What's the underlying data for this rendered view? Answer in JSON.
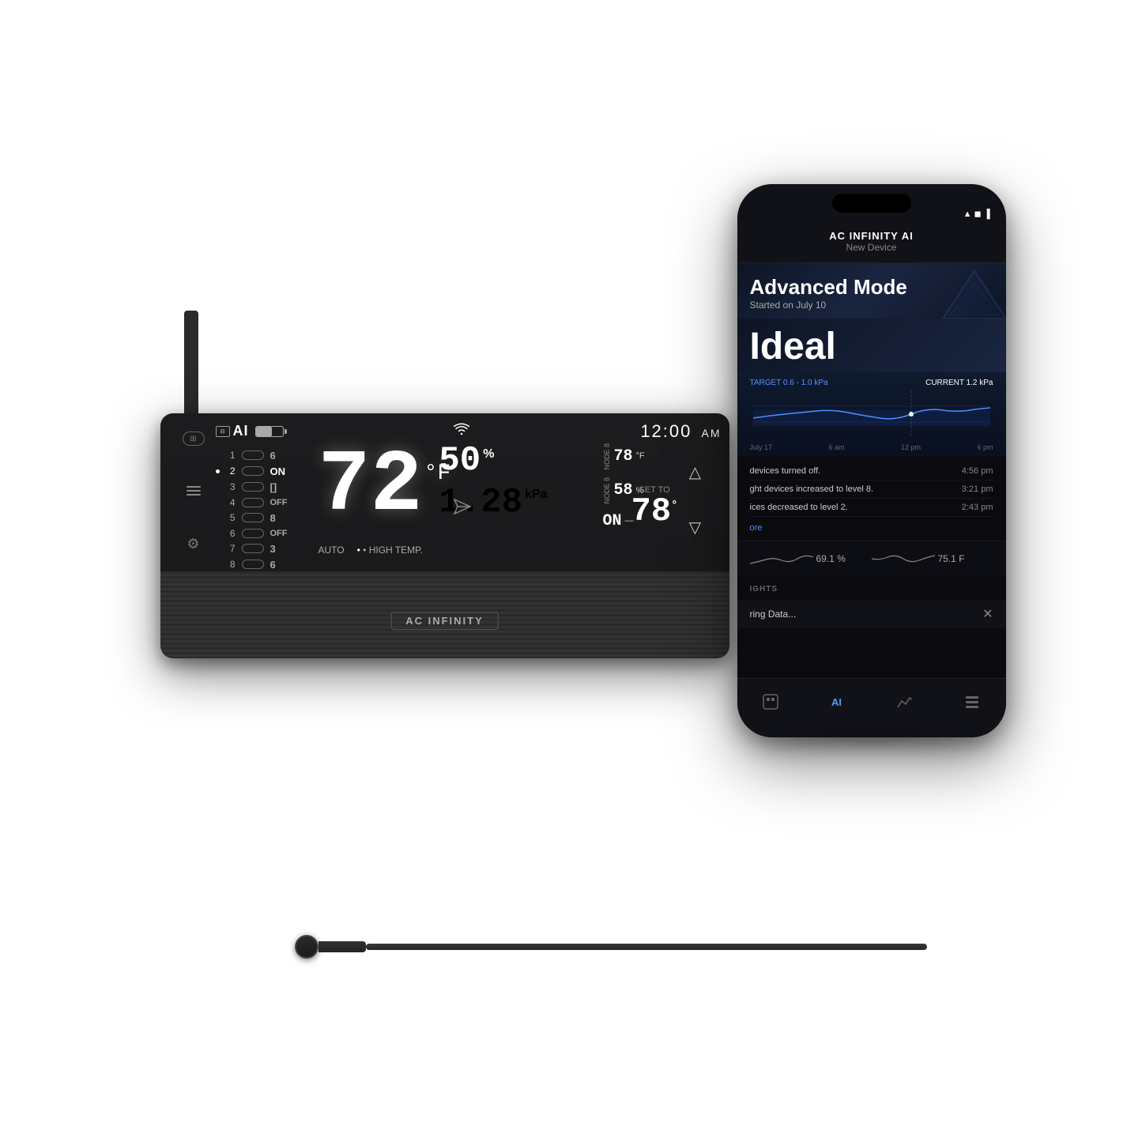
{
  "controller": {
    "brand": "AC INFINITY",
    "ai_label": "AI",
    "time": "12:00",
    "time_period": "AM",
    "temperature": "72",
    "temp_unit": "°F",
    "humidity": "50",
    "humidity_unit": "%",
    "pressure_top": "1.28",
    "pressure_unit": "kPa",
    "mode": "AUTO",
    "mode_label": "• HIGH TEMP.",
    "set_to_label": "SET TO",
    "set_to_value": "78",
    "set_to_unit": "°",
    "sensor1_label": "NODE 8",
    "sensor1_value": "78",
    "sensor1_unit": "°F",
    "sensor2_label": "NODE 8",
    "sensor2_value": "58",
    "sensor2_unit": "%",
    "sensor3_value": "ON",
    "channels": [
      {
        "num": "1",
        "val": "6",
        "active": false
      },
      {
        "num": "2",
        "val": "ON",
        "active": true
      },
      {
        "num": "3",
        "val": "[]",
        "active": false
      },
      {
        "num": "4",
        "val": "OFF",
        "active": false
      },
      {
        "num": "5",
        "val": "8",
        "active": false
      },
      {
        "num": "6",
        "val": "OFF",
        "active": false
      },
      {
        "num": "7",
        "val": "3",
        "active": false
      },
      {
        "num": "8",
        "val": "6",
        "active": false
      }
    ]
  },
  "phone": {
    "header": {
      "brand": "AC INFINITY AI",
      "device": "New Device"
    },
    "mode_card": {
      "title": "Advanced Mode",
      "subtitle": "Started on July 10"
    },
    "status": {
      "label": "Ideal"
    },
    "chart": {
      "target_label": "TARGET 0.6 - 1.0 kPa",
      "current_label": "CURRENT 1.2 kPa",
      "time_labels": [
        "July 17",
        "6 am",
        "12 pm",
        "6 pm"
      ]
    },
    "activity": [
      {
        "text": "devices turned off.",
        "time": "4:56 pm"
      },
      {
        "text": "ght devices increased to level 8.",
        "time": "3:21 pm"
      },
      {
        "text": "ices decreased to level 2.",
        "time": "2:43 pm"
      }
    ],
    "sensor_readings": [
      {
        "value": "69.1 %"
      },
      {
        "value": "75.1 F"
      }
    ],
    "insights_label": "IGHTS",
    "loading_text": "ring Data...",
    "nav_items": [
      "profile",
      "AI",
      "chart",
      "list"
    ]
  }
}
